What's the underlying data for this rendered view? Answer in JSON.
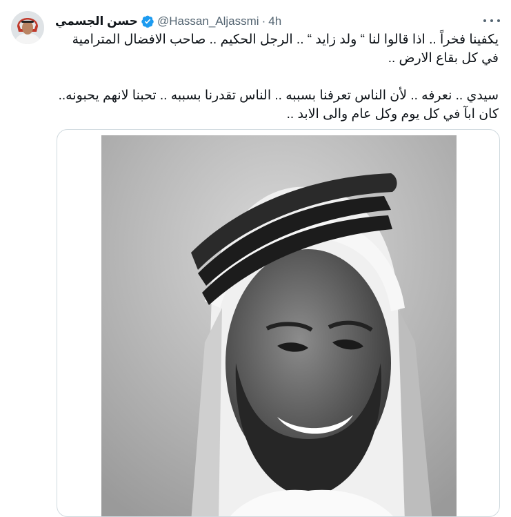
{
  "tweet": {
    "display_name": "حسن الجسمي",
    "handle": "@Hassan_Aljassmi",
    "separator": "·",
    "time": "4h",
    "paragraph1": "يكفينا فخراً .. اذا قالوا لنا “ ولد زايد “ .. الرجل الحكيم .. صاحب الافضال المترامية في كل بقاع الارض ..",
    "paragraph2": "سيدي .. نعرفه .. لأن الناس تعرفنا بسببه .. الناس تقدرنا بسببه .. تحبنا لانهم يحبونه.. كان ابآ في كل يوم وكل عام والى الابد .."
  },
  "icons": {
    "verified": "verified-badge-icon",
    "more": "more-options-icon"
  },
  "colors": {
    "verified_blue": "#1d9bf0",
    "text_primary": "#0f1419",
    "text_secondary": "#536471",
    "border": "#cfd9de"
  }
}
